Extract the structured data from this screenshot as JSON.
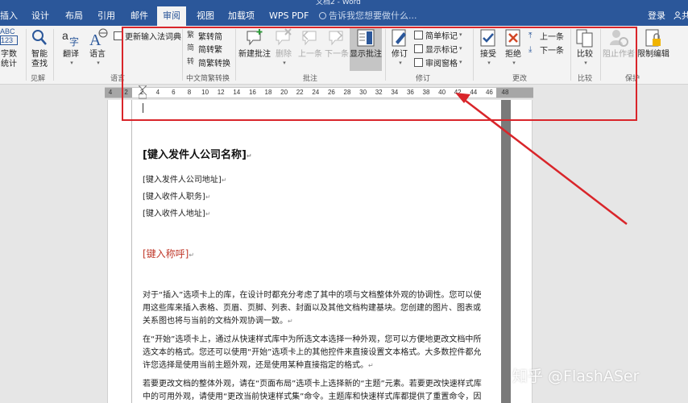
{
  "title_strip": "文档2 - Word",
  "tabs": [
    "插入",
    "设计",
    "布局",
    "引用",
    "邮件",
    "审阅",
    "视图",
    "加载项",
    "WPS PDF"
  ],
  "active_tab": "审阅",
  "tell_me": "告诉我您想要做什么...",
  "login": "登录",
  "share": "共享",
  "ribbon": {
    "wordcount": "字数\n统计",
    "abc_top": "ABC",
    "abc_num": "123",
    "smart_lookup": "智能\n查找",
    "translate": "翻译",
    "language": "语言",
    "ime_update": "更新输入法词典",
    "trad_to_simp": "繁转简",
    "simp_to_trad": "简转繁",
    "simp_trad_convert": "简繁转换",
    "new_comment": "新建批注",
    "delete": "删除",
    "previous": "上一条",
    "next": "下一条",
    "show_comments": "显示批注",
    "track_changes": "修订",
    "simple_markup": "简单标记",
    "show_markup": "显示标记",
    "reviewing_pane": "审阅窗格",
    "accept": "接受",
    "reject": "拒绝",
    "prev_change": "上一条",
    "next_change": "下一条",
    "compare": "比较",
    "block_authors": "阻止作者",
    "restrict_editing": "限制编辑",
    "groups": {
      "insights": "见解",
      "language": "语言",
      "chinese_conversion": "中文简繁转换",
      "comments": "批注",
      "tracking": "修订",
      "changes": "更改",
      "compare": "比较",
      "protect": "保护"
    }
  },
  "ruler_numbers": [
    "4",
    "2",
    "2",
    "4",
    "6",
    "8",
    "10",
    "12",
    "14",
    "16",
    "18",
    "20",
    "22",
    "24",
    "26",
    "28",
    "30",
    "32",
    "34",
    "36",
    "38",
    "40",
    "42",
    "44",
    "46",
    "48"
  ],
  "document": {
    "company": "[键入发件人公司名称]",
    "sender_address": "[键入发件人公司地址]",
    "recipient_title": "[键入收件人职务]",
    "recipient_address": "[键入收件人地址]",
    "salutation": "[键入称呼]",
    "para1": "对于“插入”选项卡上的库，在设计时都充分考虑了其中的项与文档整体外观的协调性。您可以使用这些库来插入表格、页眉、页脚、列表、封面以及其他文档构建基块。您创建的图片、图表或关系图也将与当前的文档外观协调一致。",
    "para2": "在“开始”选项卡上，通过从快速样式库中为所选文本选择一种外观，您可以方便地更改文档中所选文本的格式。您还可以使用“开始”选项卡上的其他控件来直接设置文本格式。大多数控件都允许您选择是使用当前主题外观，还是使用某种直接指定的格式。",
    "para3": "若要更改文档的整体外观，请在“页面布局”选项卡上选择新的“主题”元素。若要更改快速样式库中的可用外观，请使用“更改当前快速样式集”命令。主题库和快速样式库都提供了重置命令，因而您"
  },
  "paragraph_mark": "↵",
  "watermark": "知乎 @FlashASer",
  "colors": {
    "ribbon_blue": "#2b579a",
    "annotation_red": "#d9252a",
    "salutation_red": "#c0392b"
  }
}
